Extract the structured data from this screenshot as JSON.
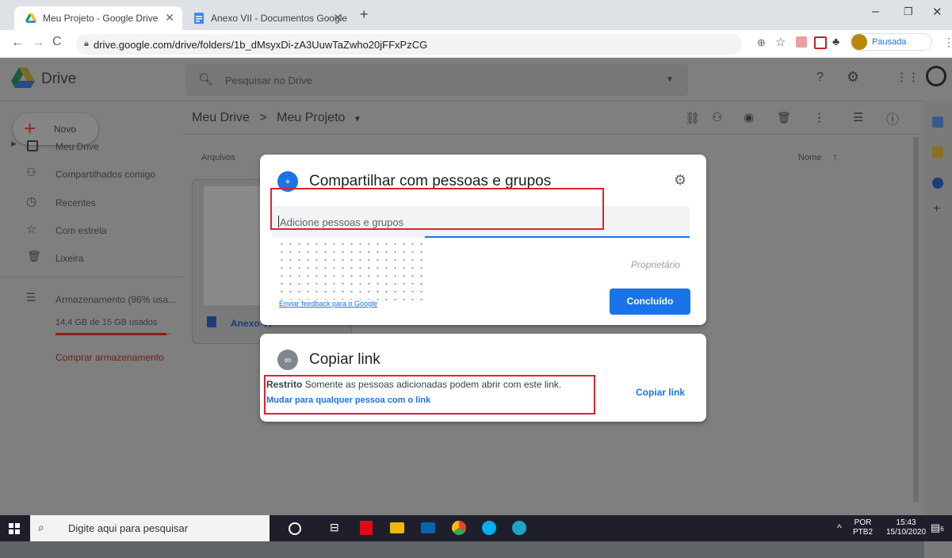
{
  "browser": {
    "tabs": [
      {
        "title": "Meu Projeto - Google Drive",
        "active": true
      },
      {
        "title": "Anexo VII - Documentos Google",
        "active": false
      }
    ],
    "url": "drive.google.com/drive/folders/1b_dMsyxDi-zA3UuwTaZwho20jFFxPzCG",
    "profile_status": "Pausada"
  },
  "drive": {
    "logo_label": "Drive",
    "search_placeholder": "Pesquisar no Drive",
    "new_button": "Novo",
    "breadcrumb": {
      "root": "Meu Drive",
      "separator": ">",
      "current": "Meu Projeto"
    },
    "section_label": "Arquivos",
    "sort_label": "Nome",
    "sidebar": [
      {
        "label": "Meu Drive",
        "icon": "drive-folder-icon"
      },
      {
        "label": "Compartilhados comigo",
        "icon": "people-icon"
      },
      {
        "label": "Recentes",
        "icon": "clock-icon"
      },
      {
        "label": "Com estrela",
        "icon": "star-icon"
      },
      {
        "label": "Lixeira",
        "icon": "trash-icon"
      }
    ],
    "storage": {
      "label": "Armazenamento (96% usa...",
      "usage": "14,4 GB de 15 GB usados",
      "buy": "Comprar armazenamento",
      "fraction_used": 0.96
    },
    "file_card_name": "Anexo VI"
  },
  "share_dialog": {
    "title": "Compartilhar com pessoas e grupos",
    "input_placeholder": "Adicione pessoas e grupos",
    "owner_label": "Proprietário",
    "feedback_link": "Enviar feedback para o Google",
    "done_button": "Concluído"
  },
  "link_dialog": {
    "title": "Copiar link",
    "restriction_bold": "Restrito",
    "restriction_text": "Somente as pessoas adicionadas podem abrir com este link.",
    "change_link": "Mudar para qualquer pessoa com o link",
    "copy_button": "Copiar link"
  },
  "taskbar": {
    "search_placeholder": "Digite aqui para pesquisar",
    "language": "POR",
    "layout": "PTB2",
    "time": "15:43",
    "date": "15/10/2020",
    "notification_count": "6"
  },
  "colors": {
    "accent": "#1a73e8",
    "highlight": "#e0212f",
    "dim_bg": "#7f7f7f"
  }
}
